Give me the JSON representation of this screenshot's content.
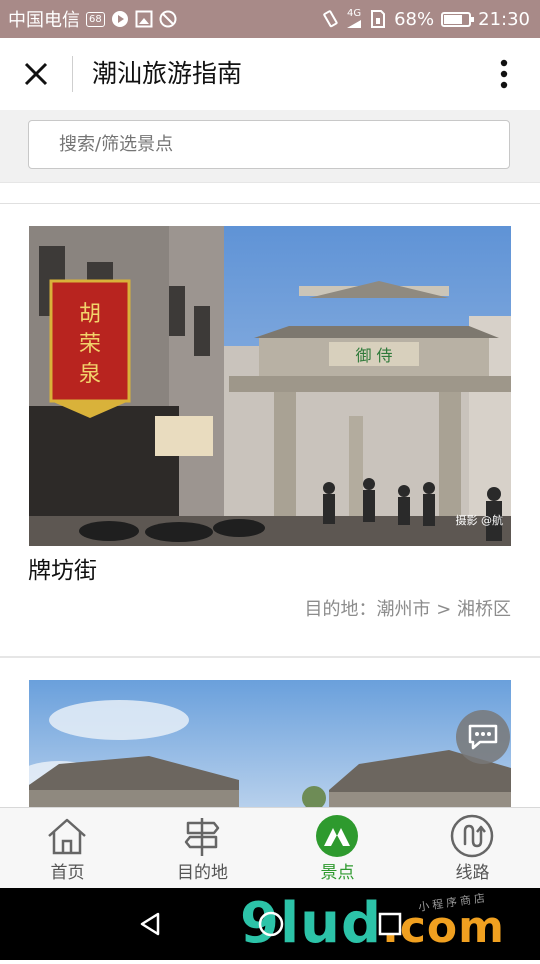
{
  "status_bar": {
    "carrier": "中国电信",
    "carrier_badge": "68",
    "network": "4G",
    "battery_percent": "68%",
    "battery_level": 0.68,
    "time": "21:30"
  },
  "header": {
    "title": "潮汕旅游指南",
    "close_icon": "close-icon",
    "more_icon": "more-vertical-icon"
  },
  "search": {
    "placeholder": "搜索/筛选景点"
  },
  "cards": [
    {
      "name": "牌坊街",
      "location": "目的地：潮州市 > 湘桥区",
      "photo_credit": "摄影 @航",
      "sign_text": "胡荣泉",
      "arch_text": "御侍"
    },
    {
      "name": "",
      "location": ""
    }
  ],
  "chat_fab": {
    "icon": "chat-bubble-icon"
  },
  "tabs": [
    {
      "label": "首页",
      "icon": "home-icon",
      "active": false
    },
    {
      "label": "目的地",
      "icon": "signpost-icon",
      "active": false
    },
    {
      "label": "景点",
      "icon": "mountain-icon",
      "active": true
    },
    {
      "label": "线路",
      "icon": "route-icon",
      "active": false
    }
  ],
  "nav_bar": {
    "watermark_main": "9lud",
    "watermark_tld": ".com",
    "watermark_sub": "小程序商店"
  },
  "colors": {
    "status_bar": "#a88a88",
    "accent": "#2e9a2e",
    "tab_inactive": "#555555",
    "watermark": "#2cc3a8"
  }
}
